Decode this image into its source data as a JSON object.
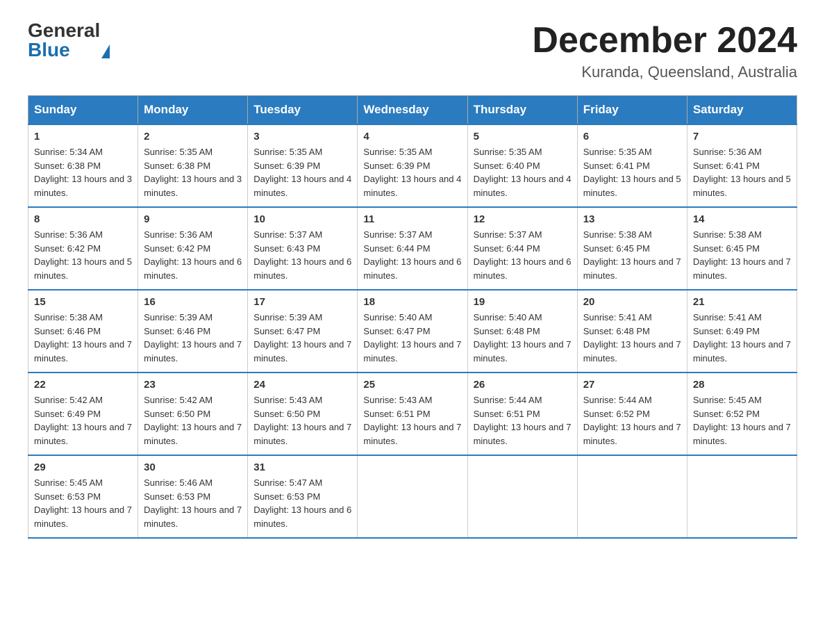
{
  "logo": {
    "general": "General",
    "blue": "Blue"
  },
  "title": "December 2024",
  "location": "Kuranda, Queensland, Australia",
  "days_of_week": [
    "Sunday",
    "Monday",
    "Tuesday",
    "Wednesday",
    "Thursday",
    "Friday",
    "Saturday"
  ],
  "weeks": [
    [
      {
        "day": "1",
        "sunrise": "5:34 AM",
        "sunset": "6:38 PM",
        "daylight": "13 hours and 3 minutes."
      },
      {
        "day": "2",
        "sunrise": "5:35 AM",
        "sunset": "6:38 PM",
        "daylight": "13 hours and 3 minutes."
      },
      {
        "day": "3",
        "sunrise": "5:35 AM",
        "sunset": "6:39 PM",
        "daylight": "13 hours and 4 minutes."
      },
      {
        "day": "4",
        "sunrise": "5:35 AM",
        "sunset": "6:39 PM",
        "daylight": "13 hours and 4 minutes."
      },
      {
        "day": "5",
        "sunrise": "5:35 AM",
        "sunset": "6:40 PM",
        "daylight": "13 hours and 4 minutes."
      },
      {
        "day": "6",
        "sunrise": "5:35 AM",
        "sunset": "6:41 PM",
        "daylight": "13 hours and 5 minutes."
      },
      {
        "day": "7",
        "sunrise": "5:36 AM",
        "sunset": "6:41 PM",
        "daylight": "13 hours and 5 minutes."
      }
    ],
    [
      {
        "day": "8",
        "sunrise": "5:36 AM",
        "sunset": "6:42 PM",
        "daylight": "13 hours and 5 minutes."
      },
      {
        "day": "9",
        "sunrise": "5:36 AM",
        "sunset": "6:42 PM",
        "daylight": "13 hours and 6 minutes."
      },
      {
        "day": "10",
        "sunrise": "5:37 AM",
        "sunset": "6:43 PM",
        "daylight": "13 hours and 6 minutes."
      },
      {
        "day": "11",
        "sunrise": "5:37 AM",
        "sunset": "6:44 PM",
        "daylight": "13 hours and 6 minutes."
      },
      {
        "day": "12",
        "sunrise": "5:37 AM",
        "sunset": "6:44 PM",
        "daylight": "13 hours and 6 minutes."
      },
      {
        "day": "13",
        "sunrise": "5:38 AM",
        "sunset": "6:45 PM",
        "daylight": "13 hours and 7 minutes."
      },
      {
        "day": "14",
        "sunrise": "5:38 AM",
        "sunset": "6:45 PM",
        "daylight": "13 hours and 7 minutes."
      }
    ],
    [
      {
        "day": "15",
        "sunrise": "5:38 AM",
        "sunset": "6:46 PM",
        "daylight": "13 hours and 7 minutes."
      },
      {
        "day": "16",
        "sunrise": "5:39 AM",
        "sunset": "6:46 PM",
        "daylight": "13 hours and 7 minutes."
      },
      {
        "day": "17",
        "sunrise": "5:39 AM",
        "sunset": "6:47 PM",
        "daylight": "13 hours and 7 minutes."
      },
      {
        "day": "18",
        "sunrise": "5:40 AM",
        "sunset": "6:47 PM",
        "daylight": "13 hours and 7 minutes."
      },
      {
        "day": "19",
        "sunrise": "5:40 AM",
        "sunset": "6:48 PM",
        "daylight": "13 hours and 7 minutes."
      },
      {
        "day": "20",
        "sunrise": "5:41 AM",
        "sunset": "6:48 PM",
        "daylight": "13 hours and 7 minutes."
      },
      {
        "day": "21",
        "sunrise": "5:41 AM",
        "sunset": "6:49 PM",
        "daylight": "13 hours and 7 minutes."
      }
    ],
    [
      {
        "day": "22",
        "sunrise": "5:42 AM",
        "sunset": "6:49 PM",
        "daylight": "13 hours and 7 minutes."
      },
      {
        "day": "23",
        "sunrise": "5:42 AM",
        "sunset": "6:50 PM",
        "daylight": "13 hours and 7 minutes."
      },
      {
        "day": "24",
        "sunrise": "5:43 AM",
        "sunset": "6:50 PM",
        "daylight": "13 hours and 7 minutes."
      },
      {
        "day": "25",
        "sunrise": "5:43 AM",
        "sunset": "6:51 PM",
        "daylight": "13 hours and 7 minutes."
      },
      {
        "day": "26",
        "sunrise": "5:44 AM",
        "sunset": "6:51 PM",
        "daylight": "13 hours and 7 minutes."
      },
      {
        "day": "27",
        "sunrise": "5:44 AM",
        "sunset": "6:52 PM",
        "daylight": "13 hours and 7 minutes."
      },
      {
        "day": "28",
        "sunrise": "5:45 AM",
        "sunset": "6:52 PM",
        "daylight": "13 hours and 7 minutes."
      }
    ],
    [
      {
        "day": "29",
        "sunrise": "5:45 AM",
        "sunset": "6:53 PM",
        "daylight": "13 hours and 7 minutes."
      },
      {
        "day": "30",
        "sunrise": "5:46 AM",
        "sunset": "6:53 PM",
        "daylight": "13 hours and 7 minutes."
      },
      {
        "day": "31",
        "sunrise": "5:47 AM",
        "sunset": "6:53 PM",
        "daylight": "13 hours and 6 minutes."
      },
      null,
      null,
      null,
      null
    ]
  ]
}
